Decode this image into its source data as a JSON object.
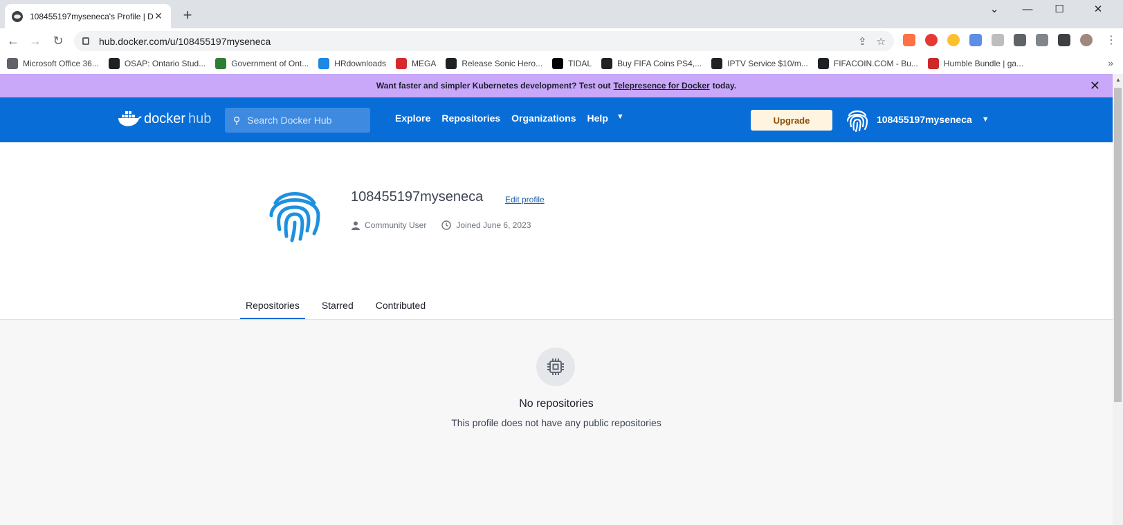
{
  "browser": {
    "tab_title": "108455197myseneca's Profile | D",
    "url": "hub.docker.com/u/108455197myseneca",
    "bookmarks": [
      {
        "label": "Microsoft Office 36...",
        "icon": "globe-icon",
        "color": "#5f6368"
      },
      {
        "label": "OSAP: Ontario Stud...",
        "icon": "osap-icon",
        "color": "#202124"
      },
      {
        "label": "Government of Ont...",
        "icon": "ontario-icon",
        "color": "#2e7d32"
      },
      {
        "label": "HRdownloads",
        "icon": "hrdownloads-icon",
        "color": "#1e88e5"
      },
      {
        "label": "MEGA",
        "icon": "mega-icon",
        "color": "#d9272e"
      },
      {
        "label": "Release Sonic Hero...",
        "icon": "github-icon",
        "color": "#202124"
      },
      {
        "label": "TIDAL",
        "icon": "tidal-icon",
        "color": "#000000"
      },
      {
        "label": "Buy FIFA Coins PS4,...",
        "icon": "diamond-icon",
        "color": "#202124"
      },
      {
        "label": "IPTV Service $10/m...",
        "icon": "gear-icon",
        "color": "#202124"
      },
      {
        "label": "FIFACOIN.COM - Bu...",
        "icon": "fifacoin-icon",
        "color": "#202124"
      },
      {
        "label": "Humble Bundle | ga...",
        "icon": "humble-icon",
        "color": "#cc2929"
      }
    ]
  },
  "banner": {
    "text_before": "Want faster and simpler Kubernetes development? Test out",
    "link": "Telepresence for Docker",
    "text_after": "today."
  },
  "hub_nav": {
    "logo_docker": "docker",
    "logo_hub": "hub",
    "search_placeholder": "Search Docker Hub",
    "links": [
      "Explore",
      "Repositories",
      "Organizations",
      "Help"
    ],
    "upgrade_label": "Upgrade",
    "username": "108455197myseneca"
  },
  "profile": {
    "username": "108455197myseneca",
    "edit_label": "Edit profile",
    "user_type": "Community User",
    "joined": "Joined June 6, 2023"
  },
  "tabs": [
    {
      "label": "Repositories",
      "active": true
    },
    {
      "label": "Starred",
      "active": false
    },
    {
      "label": "Contributed",
      "active": false
    }
  ],
  "empty_state": {
    "title": "No repositories",
    "subtitle": "This profile does not have any public repositories"
  },
  "colors": {
    "docker_blue": "#086dd7",
    "banner_purple": "#c9a7f9",
    "upgrade_bg": "#fff4e0"
  }
}
